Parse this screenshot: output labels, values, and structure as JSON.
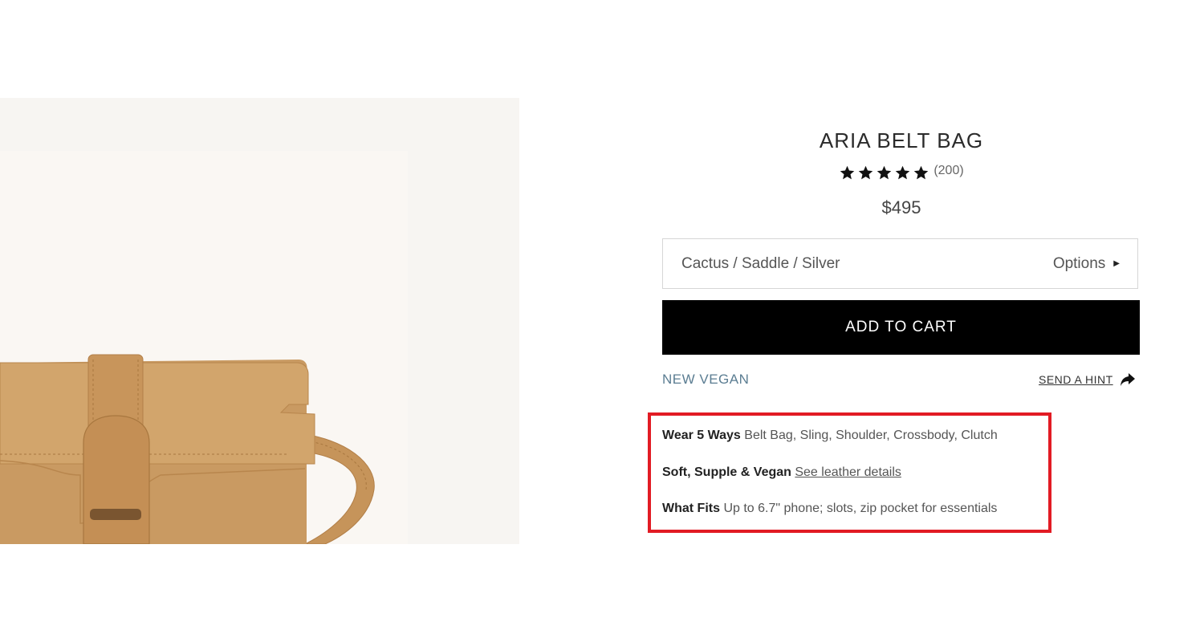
{
  "product": {
    "title": "ARIA BELT BAG",
    "review_count": "(200)",
    "star_rating": 5,
    "price": "$495"
  },
  "variant": {
    "selected": "Cactus / Saddle / Silver",
    "options_label": "Options"
  },
  "actions": {
    "add_to_cart": "ADD TO CART",
    "tag": "NEW VEGAN",
    "send_hint": "SEND A HINT"
  },
  "features": [
    {
      "label": "Wear 5 Ways",
      "text": "Belt Bag, Sling, Shoulder, Crossbody, Clutch",
      "link": ""
    },
    {
      "label": "Soft, Supple & Vegan",
      "text": "",
      "link": "See leather details"
    },
    {
      "label": "What Fits",
      "text": "Up to 6.7\" phone; slots, zip pocket for essentials",
      "link": ""
    }
  ],
  "icons": {
    "star": "star-icon",
    "caret": "caret-right-icon",
    "share": "share-arrow-icon"
  },
  "colors": {
    "button_bg": "#000000",
    "tag": "#5b7d92",
    "highlight": "#e21b24",
    "bag": "#c99a62"
  }
}
